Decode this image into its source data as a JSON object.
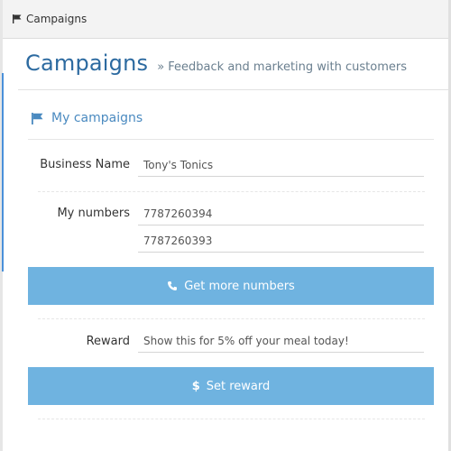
{
  "topbar": {
    "title": "Campaigns"
  },
  "header": {
    "title": "Campaigns",
    "subtitle": "» Feedback and marketing with customers"
  },
  "box": {
    "title": "My campaigns"
  },
  "form": {
    "business_name_label": "Business Name",
    "business_name_value": "Tony's Tonics",
    "numbers_label": "My numbers",
    "numbers": [
      "7787260394",
      "7787260393"
    ],
    "get_more_numbers_label": "Get more numbers",
    "reward_label": "Reward",
    "reward_value": "Show this for 5% off your meal today!",
    "set_reward_label": "Set reward",
    "set_reward_icon_glyph": "$"
  },
  "icons": [
    "flag-icon",
    "phone-icon",
    "dollar-icon"
  ],
  "colors": {
    "accent": "#2c6aa0",
    "button": "#6fb3e0",
    "box_title": "#4a8ac0"
  }
}
